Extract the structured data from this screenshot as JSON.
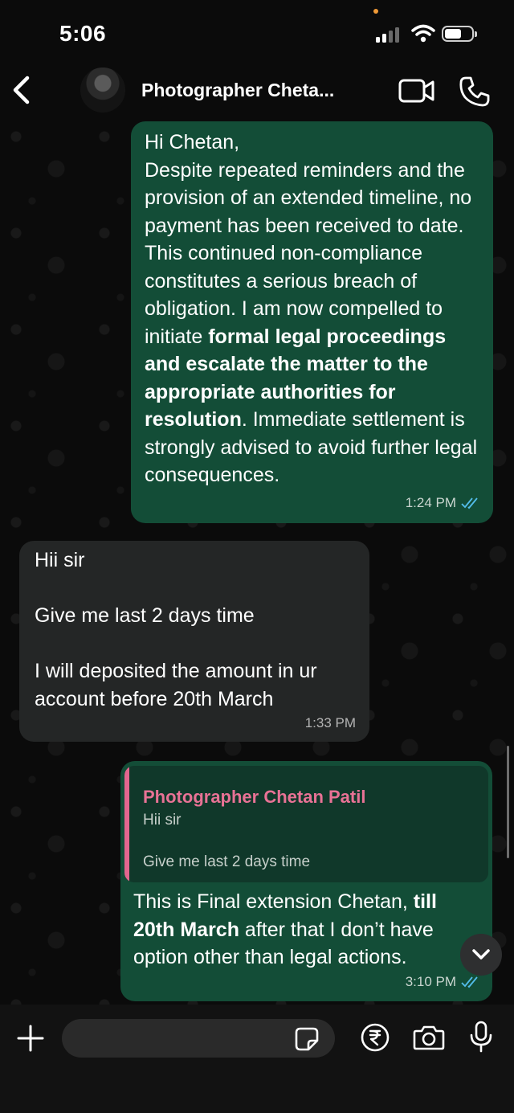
{
  "status_bar": {
    "time": "5:06"
  },
  "header": {
    "contact_name": "Photographer Cheta..."
  },
  "messages": [
    {
      "direction": "outgoing",
      "text": "Hi Chetan,\nDespite repeated reminders and the provision of an extended timeline, no payment has been received to date. This continued non-compliance constitutes a serious breach of obligation. I am now compelled to initiate formal legal proceedings and escalate the matter to the appropriate authorities for resolution. Immediate settlement is strongly advised to avoid further legal consequences.",
      "time": "1:24 PM",
      "status": "read"
    },
    {
      "direction": "incoming",
      "text": "Hii sir\n\nGive me last 2 days time\n\nI will deposited the amount in ur account before 20th March",
      "time": "1:33 PM"
    },
    {
      "direction": "outgoing",
      "quoted_author": "Photographer Chetan Patil",
      "quoted_text": "Hii sir\n\nGive me last 2 days time",
      "text": "This is Final extension Chetan, till 20th March after that I don’t have option other than legal actions.",
      "time": "3:10 PM",
      "status": "read"
    }
  ],
  "composer": {
    "placeholder": ""
  },
  "colors": {
    "outgoing_bubble": "#134d37",
    "incoming_bubble": "#242626",
    "read_ticks": "#53bdeb",
    "quote_accent": "#e2668f"
  }
}
